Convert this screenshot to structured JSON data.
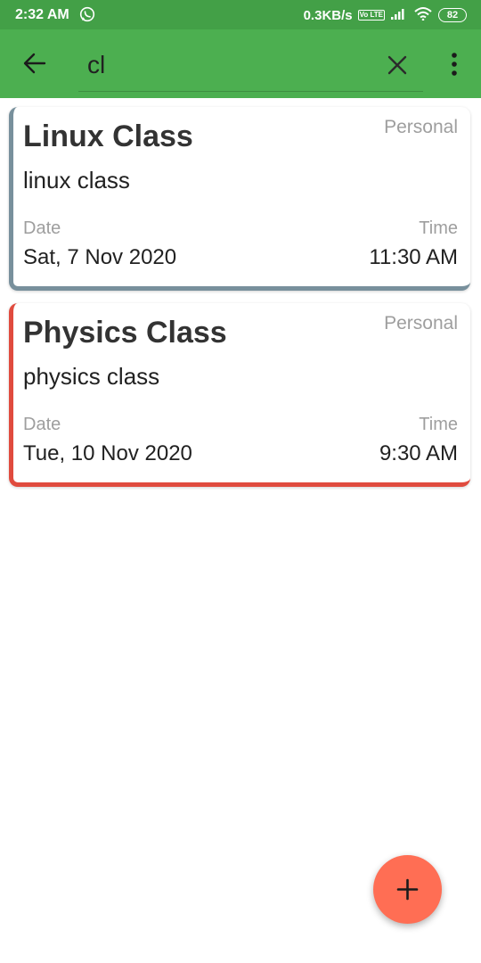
{
  "status_bar": {
    "time": "2:32 AM",
    "speed": "0.3KB/s",
    "volte": "Vo LTE",
    "battery": "82",
    "icons": [
      "whatsapp-icon",
      "volte-icon",
      "signal-icon",
      "wifi-icon",
      "battery-icon"
    ]
  },
  "toolbar": {
    "background": "#4caf50",
    "search_value": "cl",
    "icons": [
      "back-arrow-icon",
      "close-icon",
      "more-vert-icon"
    ]
  },
  "results": [
    {
      "title": "Linux Class",
      "category": "Personal",
      "description": "linux class",
      "date_label": "Date",
      "date": "Sat, 7 Nov 2020",
      "time_label": "Time",
      "time": "11:30 AM",
      "accent": "#78909c"
    },
    {
      "title": "Physics Class",
      "category": "Personal",
      "description": "physics class",
      "date_label": "Date",
      "date": "Tue, 10 Nov 2020",
      "time_label": "Time",
      "time": "9:30 AM",
      "accent": "#e04b3e"
    }
  ],
  "fab": {
    "icon": "plus-icon",
    "color": "#ff6e54"
  }
}
